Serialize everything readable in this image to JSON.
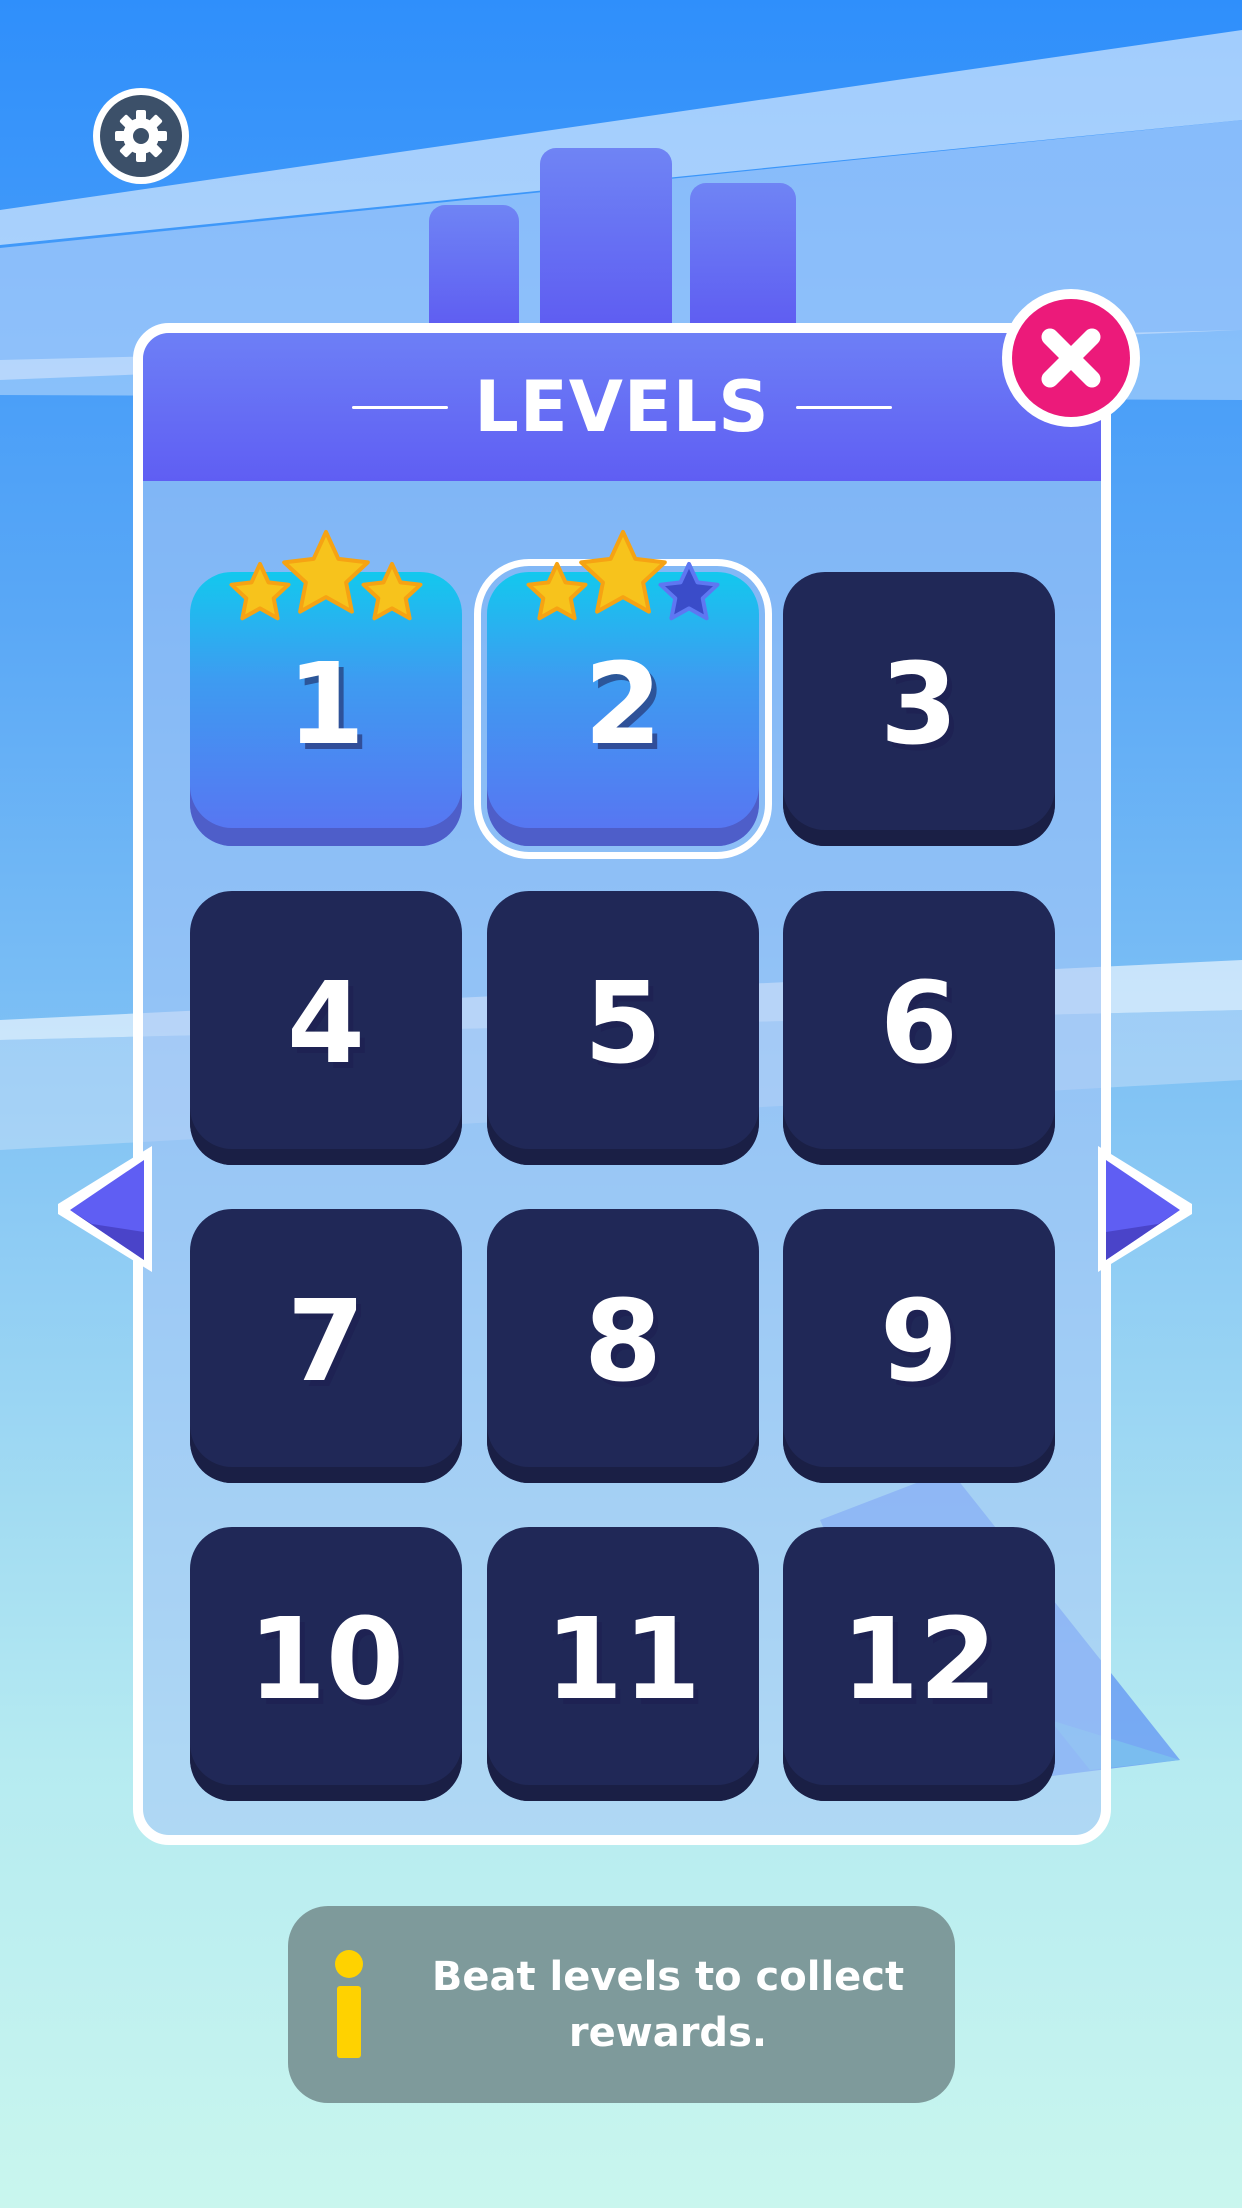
{
  "header": {
    "title": "LEVELS"
  },
  "icons": {
    "settings": "gear-icon",
    "close": "close-icon",
    "prev": "arrow-left-icon",
    "next": "arrow-right-icon",
    "info": "info-icon",
    "star": "star-icon"
  },
  "levels": [
    {
      "label": "1",
      "stars": 3,
      "state": "unlocked"
    },
    {
      "label": "2",
      "stars": 2,
      "state": "selected"
    },
    {
      "label": "3",
      "stars": 0,
      "state": "locked"
    },
    {
      "label": "4",
      "stars": 0,
      "state": "locked"
    },
    {
      "label": "5",
      "stars": 0,
      "state": "locked"
    },
    {
      "label": "6",
      "stars": 0,
      "state": "locked"
    },
    {
      "label": "7",
      "stars": 0,
      "state": "locked"
    },
    {
      "label": "8",
      "stars": 0,
      "state": "locked"
    },
    {
      "label": "9",
      "stars": 0,
      "state": "locked"
    },
    {
      "label": "10",
      "stars": 0,
      "state": "locked"
    },
    {
      "label": "11",
      "stars": 0,
      "state": "locked"
    },
    {
      "label": "12",
      "stars": 0,
      "state": "locked"
    }
  ],
  "info": {
    "line1": "Beat levels to collect",
    "line2": "rewards."
  },
  "colors": {
    "accent": "#5f5ef3",
    "close": "#ec1a7a",
    "locked_tile": "#202857",
    "unlocked_tile": "#3e9bf1",
    "star_gold": "#f7c31c",
    "star_empty": "#3a4cc9",
    "info_box": "#7e9a9b",
    "info_icon": "#ffd200"
  }
}
